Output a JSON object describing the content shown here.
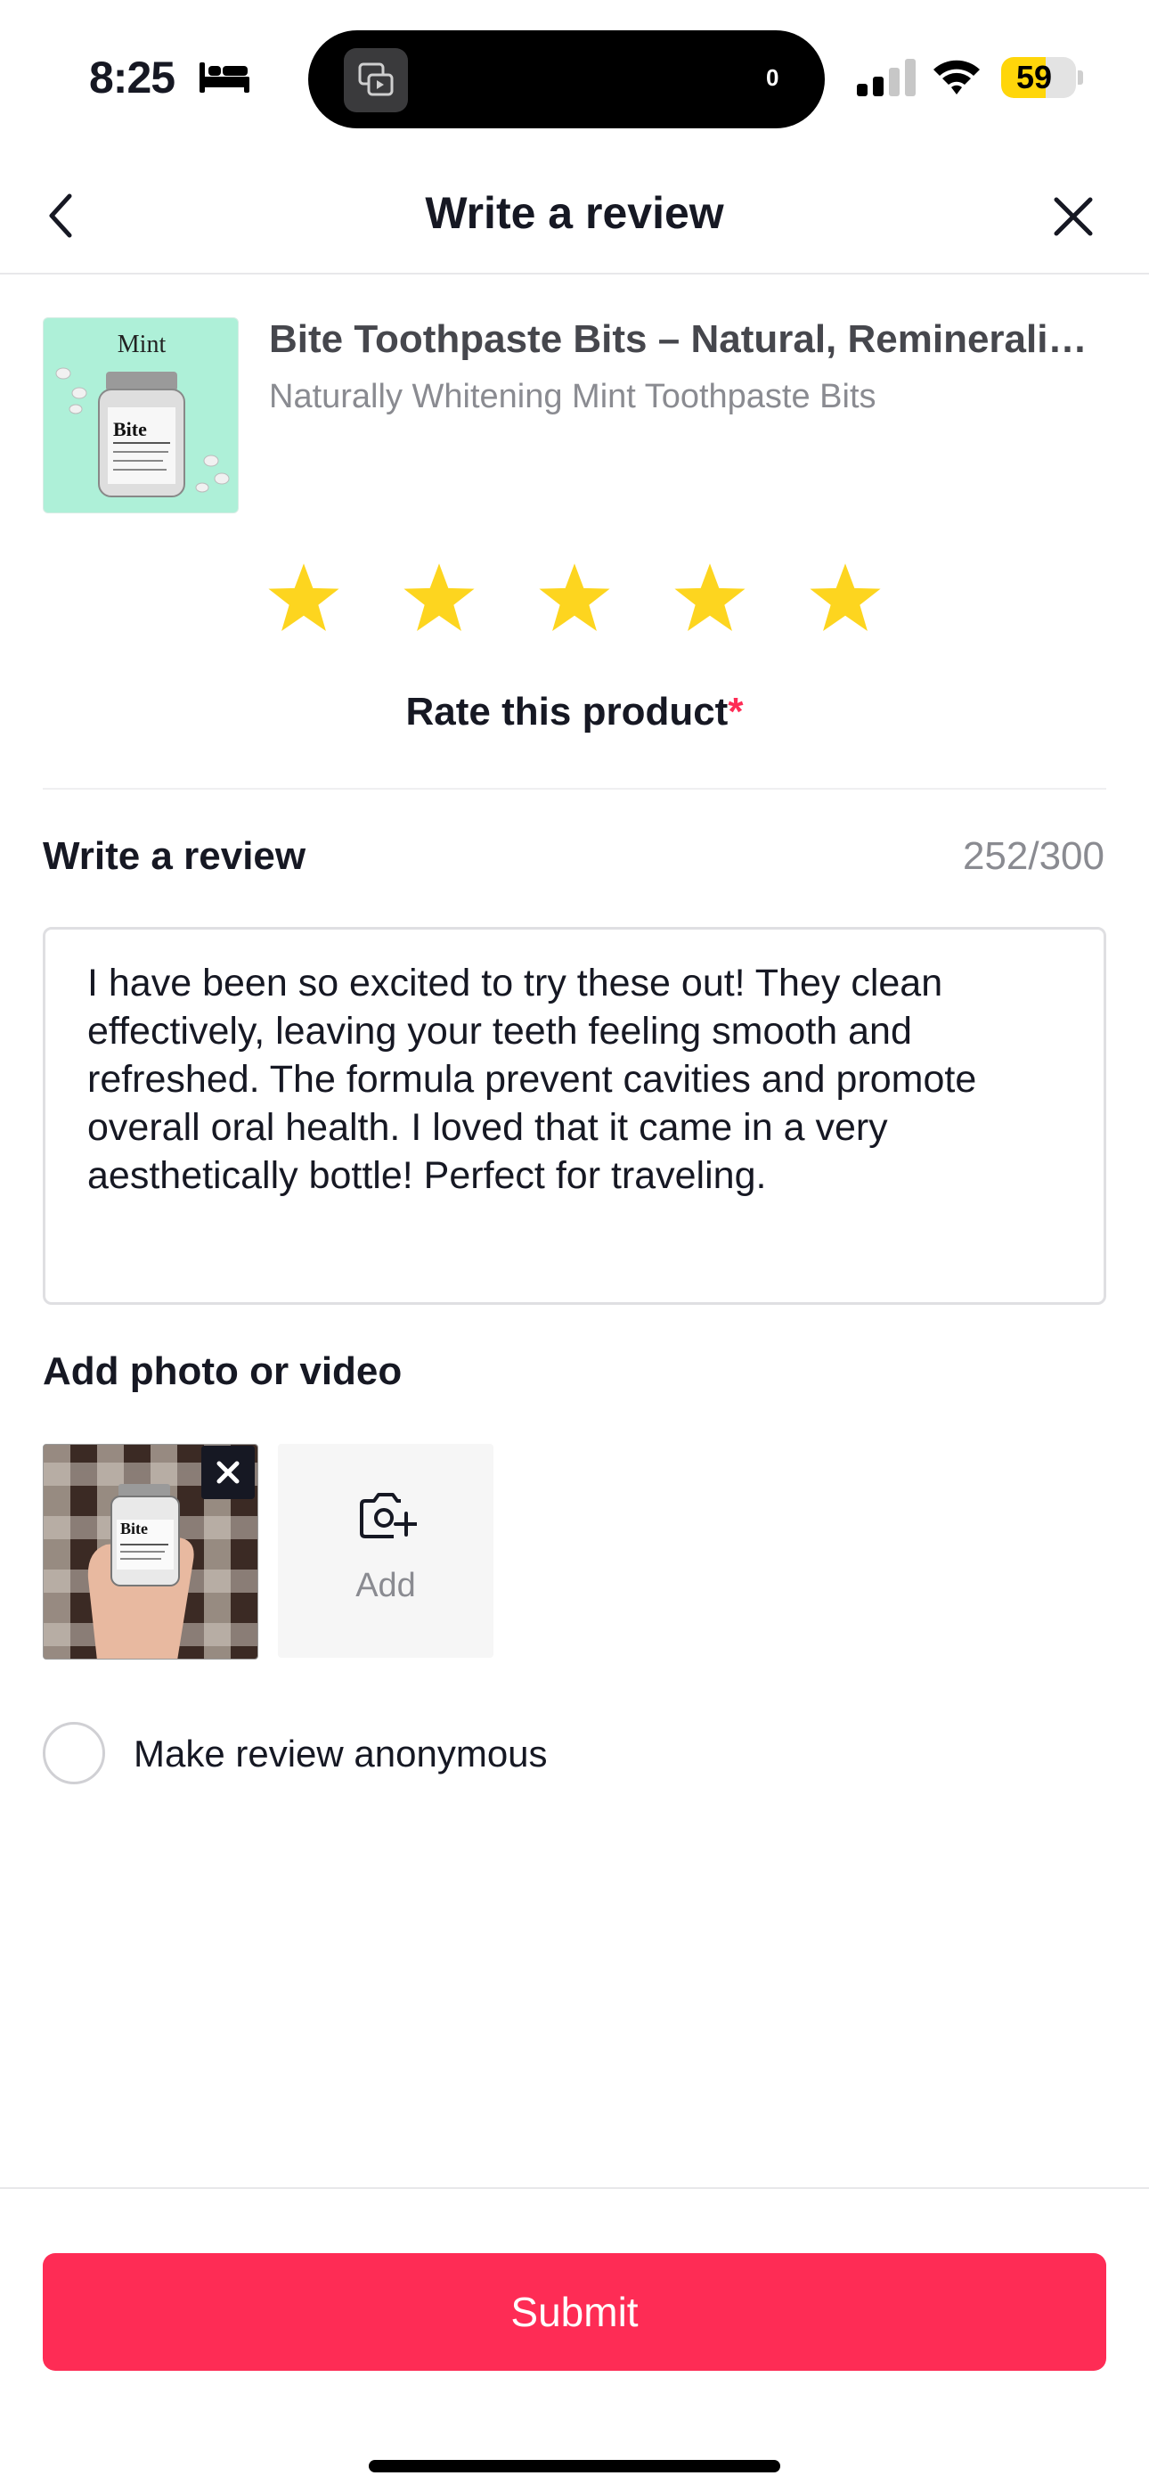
{
  "status_bar": {
    "time": "8:25",
    "activity_count": "0",
    "battery": "59",
    "battery_level": 0.59,
    "battery_color": "#ffd60a"
  },
  "nav": {
    "title": "Write a review",
    "back_icon": "chevron-left-icon",
    "close_icon": "close-icon"
  },
  "product": {
    "name": "Bite Toothpaste Bits – Natural, Remineralizing Toothpaste Tablets",
    "variant": "Naturally Whitening Mint Toothpaste Bits",
    "thumbnail_label": "Mint",
    "thumbnail_brand": "Bite"
  },
  "rating": {
    "value": 5,
    "max": 5,
    "star_color": "#fdd51f",
    "label": "Rate this product",
    "required_mark": "*"
  },
  "review": {
    "label": "Write a review",
    "char_count": "252/300",
    "text": "I have been so excited to try these out! They clean effectively, leaving your teeth feeling smooth and refreshed. The formula prevent cavities and promote overall oral health. I loved that it came in a very aesthetically bottle! Perfect for traveling."
  },
  "media": {
    "label": "Add photo or video",
    "add_label": "Add",
    "photo_brand": "Bite"
  },
  "anonymous": {
    "label": "Make review anonymous",
    "checked": false
  },
  "submit": {
    "label": "Submit",
    "color": "#fe2c55"
  }
}
